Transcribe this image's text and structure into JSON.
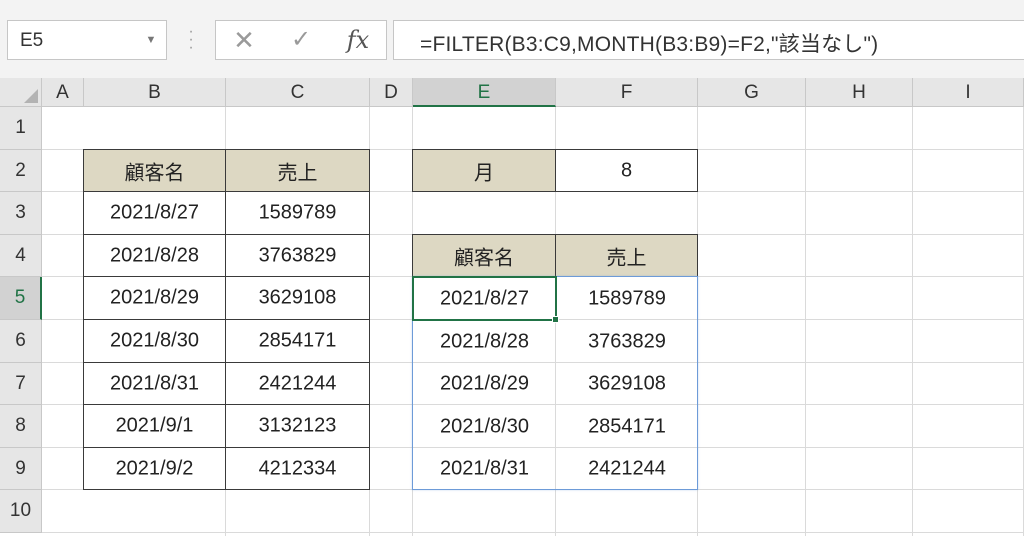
{
  "formula_bar": {
    "name_box": "E5",
    "cancel_icon": "✕",
    "enter_icon": "✓",
    "fx_label": "fx",
    "formula": "=FILTER(B3:C9,MONTH(B3:B9)=F2,\"該当なし\")"
  },
  "columns": [
    "A",
    "B",
    "C",
    "D",
    "E",
    "F",
    "G",
    "H",
    "I"
  ],
  "rows": [
    "1",
    "2",
    "3",
    "4",
    "5",
    "6",
    "7",
    "8",
    "9",
    "10"
  ],
  "active_cell": {
    "column": "E",
    "row": "5"
  },
  "source_table": {
    "headers": [
      "顧客名",
      "売上"
    ],
    "rows": [
      [
        "2021/8/27",
        "1589789"
      ],
      [
        "2021/8/28",
        "3763829"
      ],
      [
        "2021/8/29",
        "3629108"
      ],
      [
        "2021/8/30",
        "2854171"
      ],
      [
        "2021/8/31",
        "2421244"
      ],
      [
        "2021/9/1",
        "3132123"
      ],
      [
        "2021/9/2",
        "4212334"
      ]
    ]
  },
  "criteria": {
    "label": "月",
    "value": "8"
  },
  "result_table": {
    "headers": [
      "顧客名",
      "売上"
    ],
    "rows": [
      [
        "2021/8/27",
        "1589789"
      ],
      [
        "2021/8/28",
        "3763829"
      ],
      [
        "2021/8/29",
        "3629108"
      ],
      [
        "2021/8/30",
        "2854171"
      ],
      [
        "2021/8/31",
        "2421244"
      ]
    ]
  },
  "colors": {
    "header_fill": "#ddd8c3",
    "selection_green": "#217346",
    "spill_border": "#6d9bd8"
  }
}
